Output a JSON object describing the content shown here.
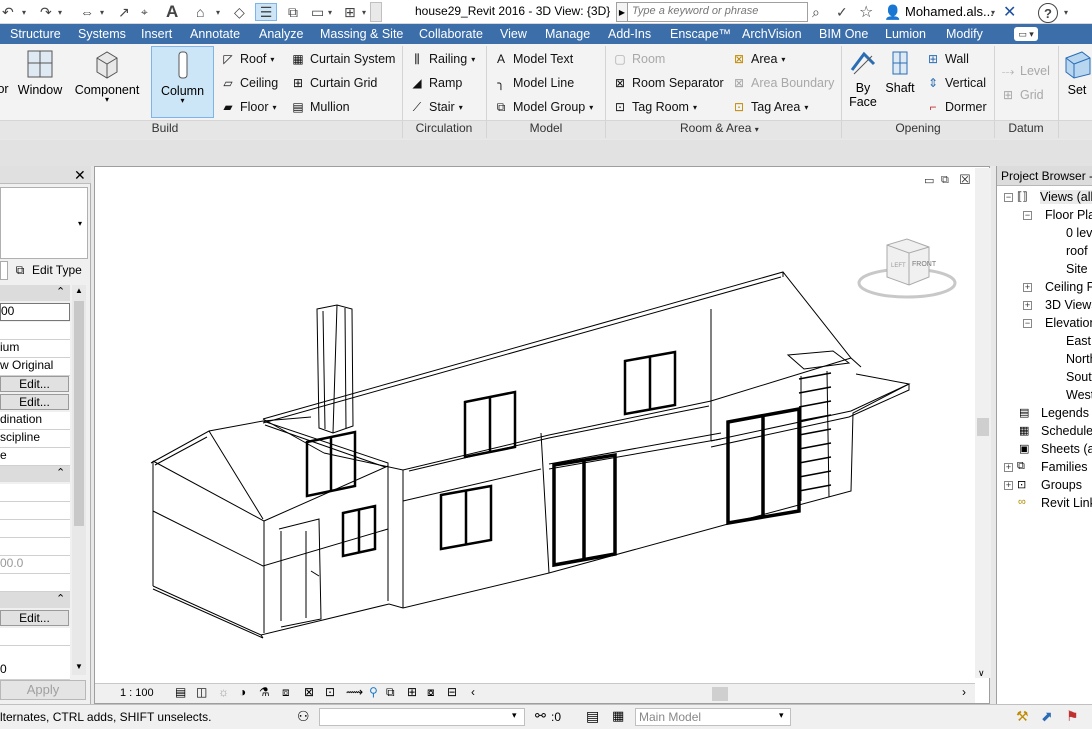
{
  "titlebar": {
    "document_title": "house29_Revit 2016 - 3D View: {3D}",
    "search_placeholder": "Type a keyword or phrase",
    "user_name": "Mohamed.als..."
  },
  "tabs": [
    "Structure",
    "Systems",
    "Insert",
    "Annotate",
    "Analyze",
    "Massing & Site",
    "Collaborate",
    "View",
    "Manage",
    "Add-Ins",
    "Enscape™",
    "ArchVision",
    "BIM One",
    "Lumion",
    "Modify"
  ],
  "ribbon": {
    "build": {
      "label": "Build",
      "partial_door": "or",
      "window": "Window",
      "component": "Component",
      "column": "Column",
      "roof": "Roof",
      "ceiling": "Ceiling",
      "floor": "Floor",
      "curtain_system": "Curtain System",
      "curtain_grid": "Curtain Grid",
      "mullion": "Mullion"
    },
    "circulation": {
      "label": "Circulation",
      "railing": "Railing",
      "ramp": "Ramp",
      "stair": "Stair"
    },
    "model": {
      "label": "Model",
      "model_text": "Model Text",
      "model_line": "Model Line",
      "model_group": "Model Group"
    },
    "room_area": {
      "label": "Room & Area",
      "room": "Room",
      "room_separator": "Room Separator",
      "tag_room": "Tag Room",
      "area": "Area",
      "area_boundary": "Area Boundary",
      "tag_area": "Tag Area"
    },
    "opening": {
      "label": "Opening",
      "by_face_1": "By",
      "by_face_2": "Face",
      "shaft": "Shaft",
      "wall": "Wall",
      "vertical": "Vertical",
      "dormer": "Dormer"
    },
    "datum": {
      "label": "Datum",
      "level": "Level",
      "grid": "Grid"
    },
    "workplane": {
      "set": "Set"
    }
  },
  "properties": {
    "edit_type": "Edit Type",
    "field_value": "00",
    "rows": [
      "ium",
      "w Original"
    ],
    "edit1": "Edit...",
    "edit2": "Edit...",
    "row_coordination": "dination",
    "row_discipline": "scipline",
    "row_e": "e",
    "row_value2": "00.0",
    "edit3": "Edit...",
    "row_zero": "0",
    "apply": "Apply"
  },
  "viewcube": {
    "left": "LEFT",
    "front": "FRONT"
  },
  "viewbar": {
    "scale": "1 : 100"
  },
  "project_browser": {
    "title": "Project Browser -",
    "nodes": [
      "Views (all)",
      "Floor Pla",
      "0 leve",
      "roof",
      "Site",
      "Ceiling P",
      "3D Views",
      "Elevation",
      "East",
      "North",
      "South",
      "West",
      "Legends",
      "Schedules",
      "Sheets (al",
      "Families",
      "Groups",
      "Revit Links"
    ]
  },
  "statusbar": {
    "hint": "lternates, CTRL adds, SHIFT unselects.",
    "zero": ":0",
    "model": "Main Model"
  },
  "colors": {
    "tab_bar": "#3c6faa",
    "selected": "#cde6f7"
  }
}
